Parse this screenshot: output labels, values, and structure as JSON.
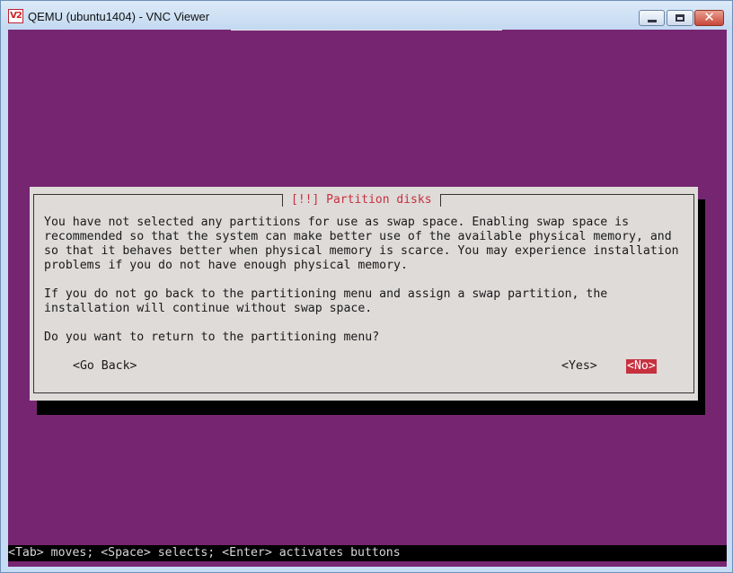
{
  "window": {
    "title": "QEMU (ubuntu1404) - VNC Viewer",
    "app_icon_text": "V2"
  },
  "dialog": {
    "title": "[!!] Partition disks",
    "paragraph1": "You have not selected any partitions for use as swap space. Enabling swap space is\nrecommended so that the system can make better use of the available physical memory, and\nso that it behaves better when physical memory is scarce. You may experience installation\nproblems if you do not have enough physical memory.",
    "paragraph2": "If you do not go back to the partitioning menu and assign a swap partition, the\ninstallation will continue without swap space.",
    "question": "Do you want to return to the partitioning menu?",
    "buttons": {
      "go_back": "<Go Back>",
      "yes": "<Yes>",
      "no": "<No>"
    }
  },
  "status_bar": {
    "text": "<Tab> moves; <Space> selects; <Enter> activates buttons"
  },
  "colors": {
    "background": "#762671",
    "dialog": "#dedbd9",
    "accent": "#c7303e"
  }
}
